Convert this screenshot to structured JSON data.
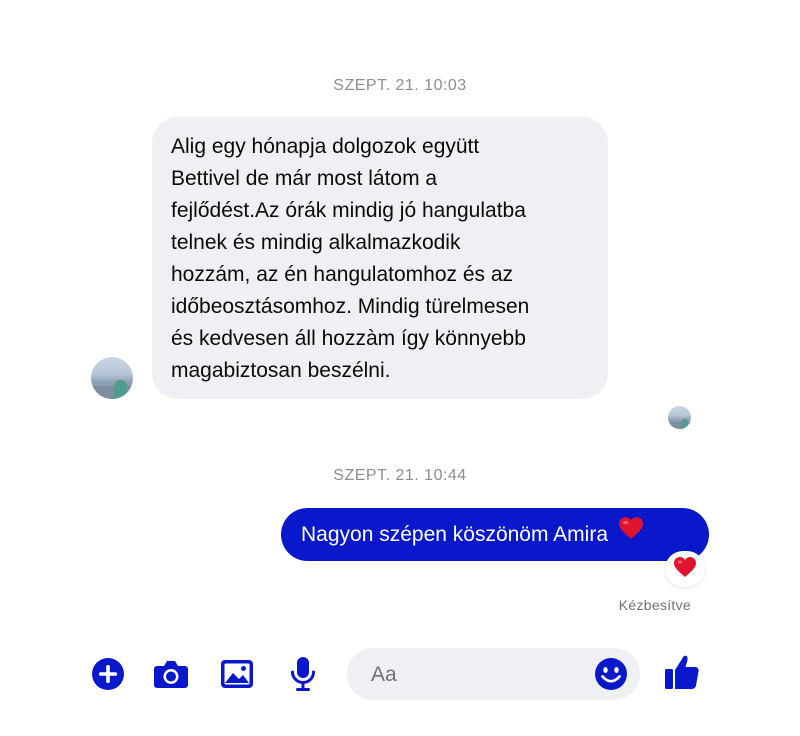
{
  "colors": {
    "accent": "#0a18cc",
    "incoming_bubble": "#eff0f3",
    "timestamp_text": "#8a8d91",
    "heart": "#e0132d"
  },
  "conversation": {
    "groups": [
      {
        "timestamp": "SZEPT. 21. 10:03",
        "message": {
          "direction": "incoming",
          "lines": [
            "Alig egy hónapja dolgozok együtt",
            "Bettivel de már most látom a",
            "fejlődést.Az órák mindig jó hangulatba",
            "telnek és mindig alkalmazkodik",
            "hozzám, az én hangulatomhoz és az",
            "időbeosztásomhoz. Mindig türelmesen",
            "és kedvesen áll hozzàm így könnyebb",
            "magabiztosan beszélni."
          ]
        }
      },
      {
        "timestamp": "SZEPT. 21. 10:44",
        "message": {
          "direction": "outgoing",
          "text": "Nagyon szépen köszönöm Amira",
          "inline_emoji": "heart-icon",
          "reaction": "heart-icon",
          "status": "Kézbesítve"
        }
      }
    ]
  },
  "composer": {
    "placeholder": "Aa",
    "value": "",
    "icons": [
      "plus-circle-icon",
      "camera-icon",
      "image-icon",
      "microphone-icon",
      "smiley-icon",
      "thumbs-up-icon"
    ]
  }
}
